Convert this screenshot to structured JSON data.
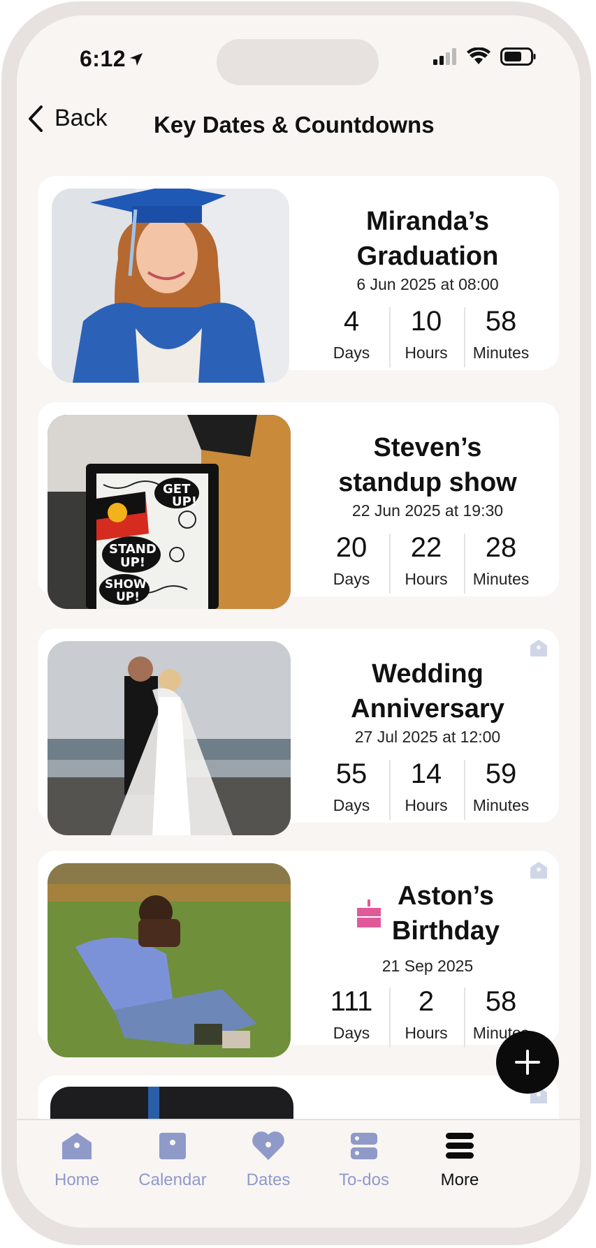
{
  "status_bar": {
    "time": "6:12"
  },
  "header": {
    "back_label": "Back",
    "title": "Key Dates & Countdowns"
  },
  "colors": {
    "accent_nav": "#8f9ac9",
    "birthday_pink": "#e05a9a",
    "fab": "#0b0b0b"
  },
  "events": [
    {
      "title": "Miranda’s\nGraduation",
      "date": "6 Jun 2025 at 08:00",
      "days": "4",
      "hours": "10",
      "minutes": "58",
      "days_label": "Days",
      "hours_label": "Hours",
      "minutes_label": "Minutes",
      "photo": "graduation-photo"
    },
    {
      "title": "Steven’s\nstandup show",
      "date": "22 Jun 2025 at 19:30",
      "days": "20",
      "hours": "22",
      "minutes": "28",
      "days_label": "Days",
      "hours_label": "Hours",
      "minutes_label": "Minutes",
      "photo": "poster-photo",
      "poster_text": [
        "GET",
        "UP!",
        "STAND",
        "UP!",
        "SHOW",
        "UP!"
      ]
    },
    {
      "title": "Wedding\nAnniversary",
      "date": "27 Jul 2025 at 12:00",
      "days": "55",
      "hours": "14",
      "minutes": "59",
      "days_label": "Days",
      "hours_label": "Hours",
      "minutes_label": "Minutes",
      "photo": "wedding-photo",
      "tag_icon": "home-tag-icon"
    },
    {
      "title": "Aston’s\nBirthday",
      "date": "21 Sep 2025",
      "days": "111",
      "hours": "2",
      "minutes": "58",
      "days_label": "Days",
      "hours_label": "Hours",
      "minutes_label": "Minutes",
      "photo": "birthday-photo",
      "tag_icon": "home-tag-icon",
      "type_icon": "birthday-cake-icon"
    }
  ],
  "fab_icon": "plus-icon",
  "nav": [
    {
      "label": "Home",
      "icon": "home-icon"
    },
    {
      "label": "Calendar",
      "icon": "calendar-icon"
    },
    {
      "label": "Dates",
      "icon": "heart-icon"
    },
    {
      "label": "To-dos",
      "icon": "todos-icon"
    },
    {
      "label": "More",
      "icon": "menu-icon",
      "active": true
    }
  ]
}
